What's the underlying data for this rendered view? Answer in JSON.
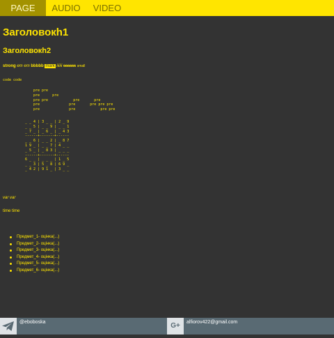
{
  "nav": {
    "tabs": [
      {
        "label": "PAGE",
        "active": true
      },
      {
        "label": "AUDIO",
        "active": false
      },
      {
        "label": "VIDEO",
        "active": false
      }
    ]
  },
  "content": {
    "h1": "Заголовокh1",
    "h2": "Заголовокh2",
    "inline": {
      "strong": "strong",
      "em1": "em",
      "em2": "em",
      "b": "bbbbb",
      "mark": "mark",
      "i": "iiiiii",
      "s": "ssssss",
      "small": "small"
    },
    "code": "code code",
    "pre_text": "pre pre\npre      pre\npre pre            pre       pre\npre              pre       pre pre pre\npre              pre            pre pre",
    "sudoku_text": "_ _ 4 | 3 _ _ | 2 _ 9\n_ _ 5 | _ _ 9 | _ _ 1\n_ 7 _ | _ 6 _ | _ 4 3\n------+-------+------\n_ _ 6 | _ _ 2 | _ 8 7\n1 9 _ | _ _ 7 | 4 _ _\n_ 5 _ | _ 8 3 | _ _ _\n------+-------+------\n6 _ _ | _ _ _ | 1 _ 5\n_ _ 3 | 5 _ 8 | 6 9 _\n_ 4 2 | 9 1 _ | 3 _ _",
    "var": "var var",
    "time": "time time",
    "subjects": [
      "Предмет_1- оцінка(...)",
      "Предмет_2- оцінка(...)",
      "Предмет_3- оцінка(...)",
      "Предмет_4- оцінка(...)",
      "Предмет_5- оцінка(...)",
      "Предмет_6- оцінка(...)"
    ]
  },
  "footer": {
    "telegram": {
      "icon": "telegram-icon",
      "text": "@eboboska"
    },
    "gplus": {
      "icon": "google-plus-icon",
      "glyph": "G+",
      "text": "alfiorov422@gmail.com"
    }
  },
  "colors": {
    "background": "#333333",
    "accent": "#ffe500",
    "tab_active": "#a39200",
    "footer": "#596a73"
  }
}
